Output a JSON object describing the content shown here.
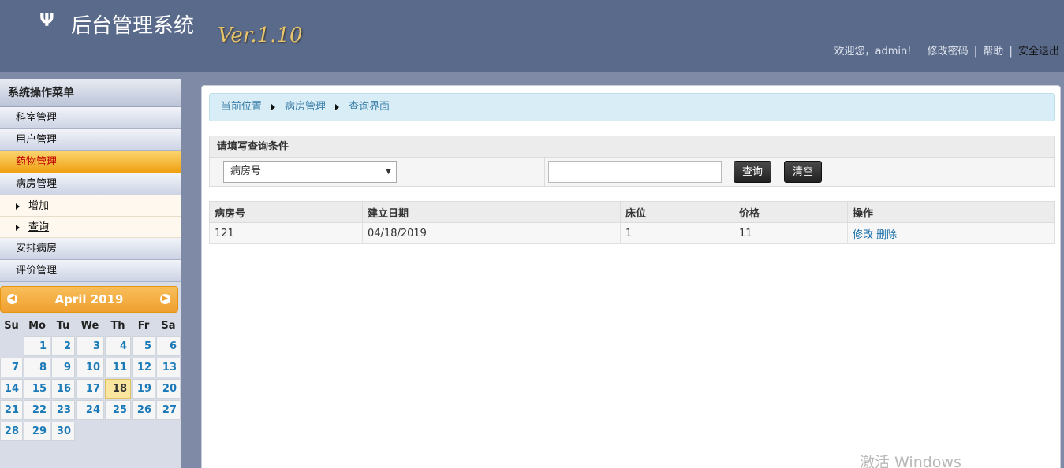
{
  "header": {
    "logo_symbol": "Ψ",
    "title": "后台管理系统",
    "version": "Ver.1.10",
    "welcome": "欢迎您，admin!",
    "change_password": "修改密码",
    "help": "帮助",
    "logout": "安全退出",
    "separator": "|"
  },
  "sidebar": {
    "title": "系统操作菜单",
    "items": [
      {
        "label": "科室管理"
      },
      {
        "label": "用户管理"
      },
      {
        "label": "药物管理"
      },
      {
        "label": "病房管理"
      },
      {
        "label": "增加"
      },
      {
        "label": "查询"
      },
      {
        "label": "安排病房"
      },
      {
        "label": "评价管理"
      }
    ]
  },
  "calendar": {
    "title": "April 2019",
    "prev_icon": "chevron-left-icon",
    "next_icon": "chevron-right-icon",
    "weekdays": [
      "Su",
      "Mo",
      "Tu",
      "We",
      "Th",
      "Fr",
      "Sa"
    ],
    "days": [
      "1",
      "2",
      "3",
      "4",
      "5",
      "6",
      "7",
      "8",
      "9",
      "10",
      "11",
      "12",
      "13",
      "14",
      "15",
      "16",
      "17",
      "18",
      "19",
      "20",
      "21",
      "22",
      "23",
      "24",
      "25",
      "26",
      "27",
      "28",
      "29",
      "30"
    ],
    "today": "18"
  },
  "breadcrumb": {
    "items": [
      "当前位置",
      "病房管理",
      "查询界面"
    ]
  },
  "query": {
    "heading": "请填写查询条件",
    "field_selected": "病房号",
    "input_value": "",
    "search_label": "查询",
    "clear_label": "清空"
  },
  "table": {
    "columns": [
      "病房号",
      "建立日期",
      "床位",
      "价格",
      "操作"
    ],
    "rows": [
      {
        "room": "121",
        "date": "04/18/2019",
        "beds": "1",
        "price": "11",
        "edit": "修改",
        "delete": "删除"
      }
    ]
  },
  "watermark": "激活 Windows",
  "colors": {
    "header_bg": "#5a6a8a",
    "version_gold": "#e8c46a",
    "active_menu": "#f0a010",
    "calendar_accent": "#f0a030",
    "breadcrumb_bg": "#d9edf7",
    "link_blue": "#1a6fa8"
  }
}
